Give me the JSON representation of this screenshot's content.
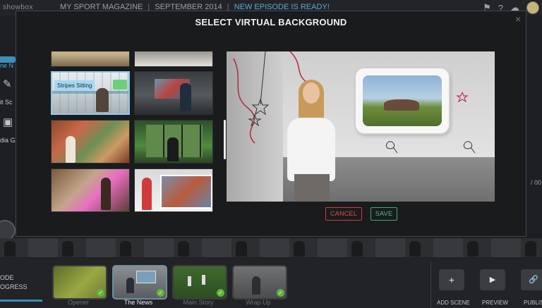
{
  "app": {
    "logo": "showbox",
    "title": "MY SPORT MAGAZINE",
    "date": "SEPTEMBER 2014",
    "separator": "|",
    "notice": "NEW EPISODE IS READY!"
  },
  "left_rail": {
    "items": [
      "ne N",
      "it Sc",
      "dia Ga"
    ],
    "slash_label": "/ 00"
  },
  "modal": {
    "title": "SELECT VIRTUAL BACKGROUND",
    "close_label": "×",
    "selected_tooltip": "Stripes Sitting",
    "cancel_label": "CANCEL",
    "save_label": "SAVE"
  },
  "bottom": {
    "progress_lines": [
      "ODE",
      "OGRESS"
    ],
    "scenes": [
      {
        "label": "Opener",
        "active": false,
        "checked": true
      },
      {
        "label": "The News",
        "active": true,
        "checked": true
      },
      {
        "label": "Main Story",
        "active": false,
        "checked": true
      },
      {
        "label": "Wrap Up",
        "active": false,
        "checked": true
      }
    ],
    "actions": [
      {
        "label": "ADD SCENE",
        "icon": "plus-icon",
        "glyph": "+"
      },
      {
        "label": "PREVIEW",
        "icon": "play-icon",
        "glyph": "▶"
      },
      {
        "label": "PUBLIS",
        "icon": "link-icon",
        "glyph": "🔗"
      }
    ]
  },
  "colors": {
    "accent_blue": "#3d8fbd",
    "cancel_red": "#d9534b",
    "save_green": "#4fc08a",
    "check_green": "#63b33d"
  }
}
